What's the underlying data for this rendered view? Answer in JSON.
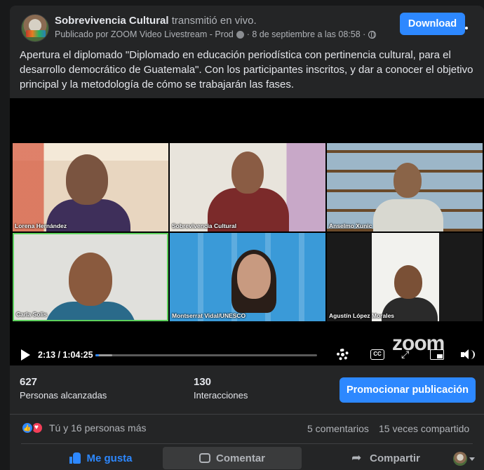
{
  "post": {
    "page_name": "Sobrevivencia Cultural",
    "action": " transmitió en vivo.",
    "publisher": "Publicado por ZOOM Video Livestream - Prod",
    "date": "· 8 de septiembre a las 08:58 ·",
    "text": "Apertura el diplomado \"Diplomado en educación periodística con pertinencia cultural, para el desarrollo democrático de Guatemala\". Con los participantes inscritos, y dar a conocer el objetivo principal y la metodología de cómo se trabajarán las fases."
  },
  "header": {
    "download_label": "Download"
  },
  "video": {
    "participants": [
      "Lorena Hernández",
      "Sobrevivencia Cultural",
      "Anselmo Xunic",
      "Carla Solis",
      "Montserrat Vidal/UNESCO",
      "Agustín López Morales"
    ],
    "watermark": "zoom",
    "time_current": "2:13",
    "time_total": "1:04:25",
    "time_display": "2:13 / 1:04:25",
    "progress_played": 0.015,
    "progress_buffered": 0.075,
    "cc_label": "CC"
  },
  "stats": {
    "reach_count": "627",
    "reach_label": "Personas alcanzadas",
    "interactions_count": "130",
    "interactions_label": "Interacciones",
    "promote_label": "Promocionar publicación"
  },
  "engagement": {
    "reactions_text": "Tú y 16 personas más",
    "comments": "5 comentarios",
    "shares": "15 veces compartido"
  },
  "actions": {
    "like": "Me gusta",
    "comment": "Comentar",
    "share": "Compartir"
  },
  "colors": {
    "accent": "#2d88ff",
    "card_bg": "#242526",
    "page_bg": "#18191a",
    "active_speaker": "#5dd15d"
  }
}
